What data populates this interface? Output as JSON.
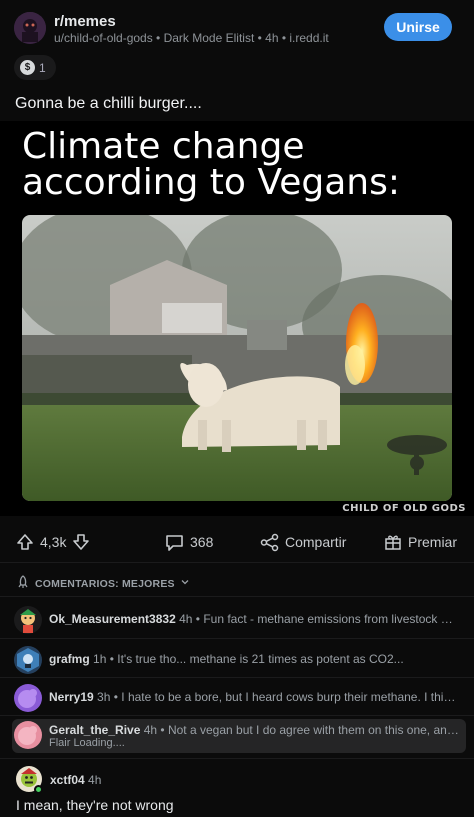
{
  "post": {
    "subreddit": "r/memes",
    "meta": "u/child-of-old-gods • Dark Mode Elitist • 4h • i.redd.it",
    "join_label": "Unirse",
    "award_count": "1",
    "title": "Gonna be a chilli burger...."
  },
  "meme": {
    "caption": "Climate change according to Vegans:",
    "watermark": "CHILD OF OLD GODS"
  },
  "actions": {
    "votes": "4,3k",
    "comments": "368",
    "share_label": "Compartir",
    "award_label": "Premiar"
  },
  "comments_header": {
    "sort_label": "COMENTARIOS: MEJORES"
  },
  "comments": [
    {
      "user": "Ok_Measurement3832",
      "time": "4h",
      "snippet": "Fun fact - methane emissions from livestock actuall..."
    },
    {
      "user": "grafmg",
      "time": "1h",
      "snippet": "It's true tho... methane is 21 times as potent as CO2..."
    },
    {
      "user": "Nerry19",
      "time": "3h",
      "snippet": "I hate to be a bore, but I heard cows burp their methane. I think a fi..."
    },
    {
      "user": "Geralt_the_Rive",
      "time": "4h",
      "snippet": "Not a vegan but I do agree with them on this one, animal ra...",
      "flair": "Flair Loading...."
    }
  ],
  "top_comment": {
    "user": "xctf04",
    "time": "4h",
    "body": "I mean, they're not wrong"
  },
  "colors": {
    "accent": "#3b8fe8",
    "background": "#0b0b0b",
    "online": "#46d160"
  }
}
